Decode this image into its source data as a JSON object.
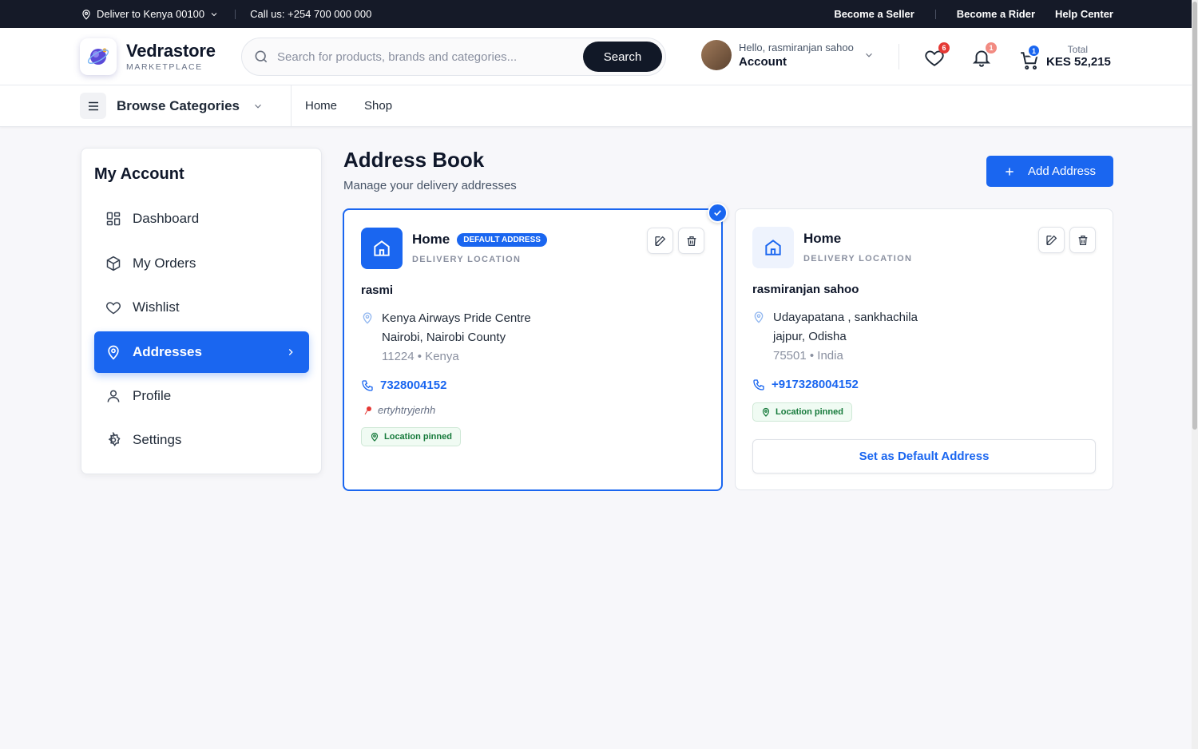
{
  "topbar": {
    "deliver": "Deliver to Kenya 00100",
    "call": "Call us: +254 700 000 000",
    "become_seller": "Become a Seller",
    "become_rider": "Become a Rider",
    "help_center": "Help Center"
  },
  "header": {
    "brand_name": "Vedrastore",
    "brand_sub": "MARKETPLACE",
    "search_placeholder": "Search for products, brands and categories...",
    "search_button": "Search",
    "hello": "Hello, rasmiranjan sahoo",
    "account": "Account",
    "wishlist_count": "6",
    "notif_count": "1",
    "cart_count": "1",
    "total_label": "Total",
    "total_value": "KES 52,215"
  },
  "nav": {
    "browse": "Browse Categories",
    "links": [
      "Home",
      "Shop"
    ]
  },
  "sidebar": {
    "title": "My Account",
    "items": [
      {
        "label": "Dashboard",
        "icon": "grid-icon"
      },
      {
        "label": "My Orders",
        "icon": "box-icon"
      },
      {
        "label": "Wishlist",
        "icon": "heart-icon"
      },
      {
        "label": "Addresses",
        "icon": "location-icon"
      },
      {
        "label": "Profile",
        "icon": "user-icon"
      },
      {
        "label": "Settings",
        "icon": "gear-icon"
      }
    ]
  },
  "main": {
    "title": "Address Book",
    "subtitle": "Manage your delivery addresses",
    "add_button": "Add Address",
    "cards": [
      {
        "type": "Home",
        "badge": "DEFAULT ADDRESS",
        "sub": "DELIVERY LOCATION",
        "name": "rasmi",
        "line1": "Kenya Airways Pride Centre",
        "line2": "Nairobi, Nairobi County",
        "line3": "11224 • Kenya",
        "phone": "7328004152",
        "note": "ertyhtryjerhh",
        "pinned": "Location pinned"
      },
      {
        "type": "Home",
        "sub": "DELIVERY LOCATION",
        "name": "rasmiranjan sahoo",
        "line1": "Udayapatana , sankhachila",
        "line2": "jajpur, Odisha",
        "line3": "75501 • India",
        "phone": "+917328004152",
        "pinned": "Location pinned",
        "set_default": "Set as Default Address"
      }
    ]
  },
  "colors": {
    "accent": "#1a66f0",
    "dark": "#151a28",
    "badge_red": "#e53935"
  }
}
